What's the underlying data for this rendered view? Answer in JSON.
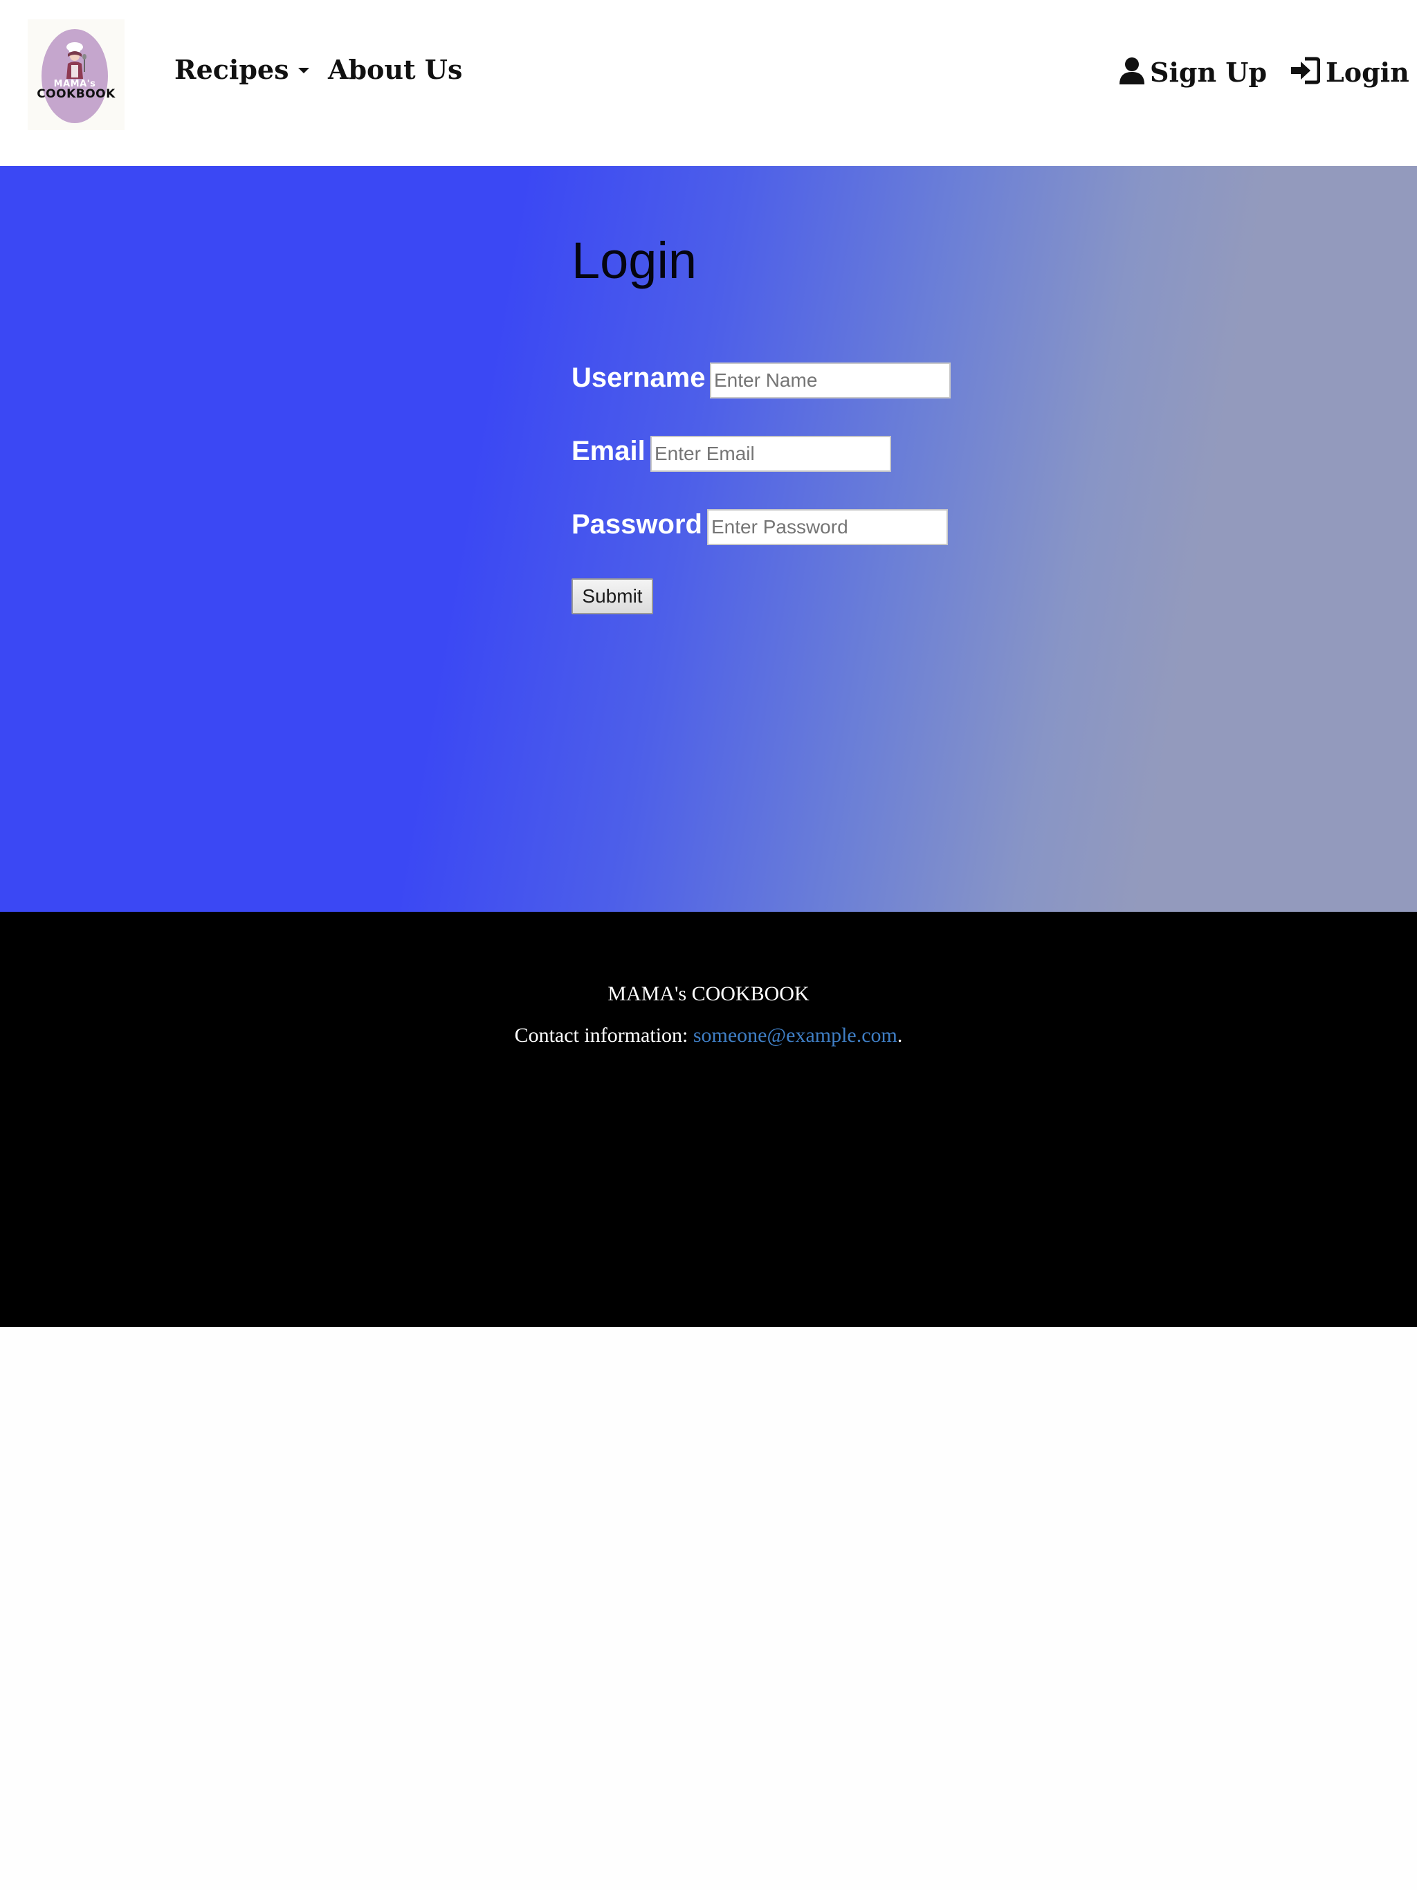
{
  "nav": {
    "logo_top_text": "MAMA's",
    "logo_bottom_text": "COOKBOOK",
    "recipes_label": "Recipes",
    "about_label": "About Us",
    "signup_label": "Sign Up",
    "login_label": "Login"
  },
  "form": {
    "title": "Login",
    "username": {
      "label": "Username",
      "placeholder": "Enter Name"
    },
    "email": {
      "label": "Email",
      "placeholder": "Enter Email"
    },
    "password": {
      "label": "Password",
      "placeholder": "Enter Password"
    },
    "submit_label": "Submit"
  },
  "footer": {
    "brand": "MAMA's COOKBOOK",
    "contact_prefix": "Contact information: ",
    "contact_email": "someone@example.com",
    "contact_suffix": "."
  },
  "colors": {
    "hero_gradient_start": "#3b48f4",
    "hero_gradient_end": "#939abd",
    "footer_bg": "#000000",
    "link": "#3f7ec4",
    "logo_oval": "#c5a6cd"
  },
  "icons": {
    "signup": "user-icon",
    "login": "sign-in-icon",
    "recipes_dropdown": "caret-down-icon"
  }
}
